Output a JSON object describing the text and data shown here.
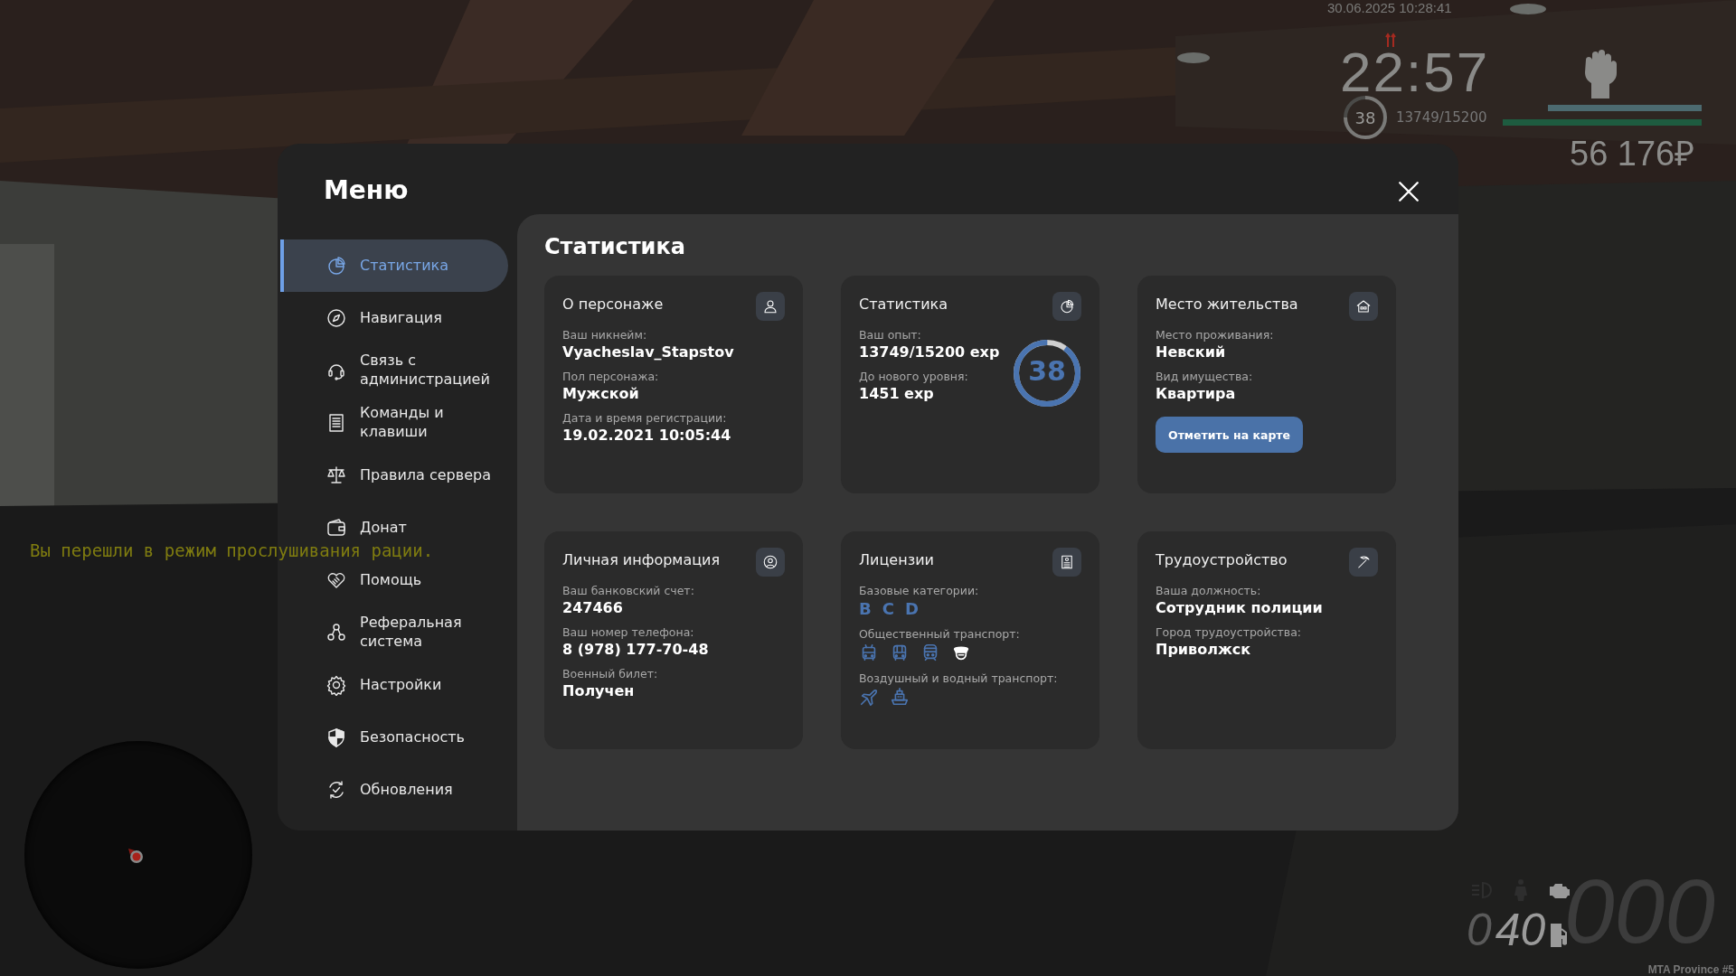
{
  "hud": {
    "datetime": "30.06.2025 10:28:41",
    "clock": "22:57",
    "level": "38",
    "exp": "13749/15200",
    "bars": [
      {
        "kind": "armor",
        "level": 1
      },
      {
        "kind": "health",
        "level": 1
      }
    ],
    "money": "56 176₽"
  },
  "chat": [
    "Вы перешли в режим прослушивания рации."
  ],
  "vehicle": {
    "fuel_lead": "0",
    "fuel": "40",
    "speed": "000"
  },
  "server": "MTA Province #5",
  "menu": {
    "title": "Меню",
    "sidebar": {
      "items": [
        {
          "label": "Статистика",
          "selected": true
        },
        {
          "label": "Навигация",
          "selected": false
        },
        {
          "label": "Связь с администрацией",
          "selected": false
        },
        {
          "label": "Команды и клавиши",
          "selected": false
        },
        {
          "label": "Правила сервера",
          "selected": false
        },
        {
          "label": "Донат",
          "selected": false
        },
        {
          "label": "Помощь",
          "selected": false
        },
        {
          "label": "Реферальная система",
          "selected": false
        },
        {
          "label": "Настройки",
          "selected": false
        },
        {
          "label": "Безопасность",
          "selected": false
        },
        {
          "label": "Обновления",
          "selected": false
        }
      ]
    },
    "page": {
      "title": "Статистика",
      "cards": [
        {
          "title": "О персонаже",
          "fields": [
            {
              "kind": "text",
              "label": "Ваш никнейм:",
              "value": "Vyacheslav_Stapstov"
            },
            {
              "kind": "text",
              "label": "Пол персонажа:",
              "value": "Мужской"
            },
            {
              "kind": "text",
              "label": "Дата и время регистрации:",
              "value": "19.02.2021 10:05:44"
            }
          ]
        },
        {
          "title": "Статистика",
          "ring": {
            "value": "38",
            "level": 0.9
          },
          "fields": [
            {
              "kind": "text",
              "label": "Ваш опыт:",
              "value": "13749/15200 exp"
            },
            {
              "kind": "text",
              "label": "До нового уровня:",
              "value": "1451 exp"
            }
          ]
        },
        {
          "title": "Место жительства",
          "fields": [
            {
              "kind": "text",
              "label": "Место проживания:",
              "value": "Невский"
            },
            {
              "kind": "text",
              "label": "Вид имущества:",
              "value": "Квартира"
            }
          ],
          "button": "Отметить на карте"
        },
        {
          "title": "Личная информация",
          "fields": [
            {
              "kind": "text",
              "label": "Ваш банковский счет:",
              "value": "247466"
            },
            {
              "kind": "text",
              "label": "Ваш номер телефона:",
              "value": "8 (978) 177-70-48"
            },
            {
              "kind": "text",
              "label": "Военный билет:",
              "value": "Получен"
            }
          ]
        },
        {
          "title": "Лицензии",
          "fields": [
            {
              "kind": "letters",
              "label": "Базовые категории:",
              "values": [
                "B",
                "C",
                "D"
              ]
            },
            {
              "kind": "icons",
              "label": "Общественный транспорт:",
              "items": [
                {
                  "kind": "bus",
                  "color": "#4a74b0"
                },
                {
                  "kind": "tram",
                  "color": "#4a74b0"
                },
                {
                  "kind": "train",
                  "color": "#4a74b0"
                },
                {
                  "kind": "cap",
                  "color": "#ffffff"
                }
              ]
            },
            {
              "kind": "icons",
              "label": "Воздушный и водный транспорт:",
              "items": [
                {
                  "kind": "airplane",
                  "color": "#4a74b0"
                },
                {
                  "kind": "ship",
                  "color": "#4a74b0"
                }
              ]
            }
          ]
        },
        {
          "title": "Трудоустройство",
          "fields": [
            {
              "kind": "text",
              "label": "Ваша должность:",
              "value": "Сотрудник полиции"
            },
            {
              "kind": "text",
              "label": "Город трудоустройства:",
              "value": "Приволжск"
            }
          ]
        }
      ]
    }
  }
}
